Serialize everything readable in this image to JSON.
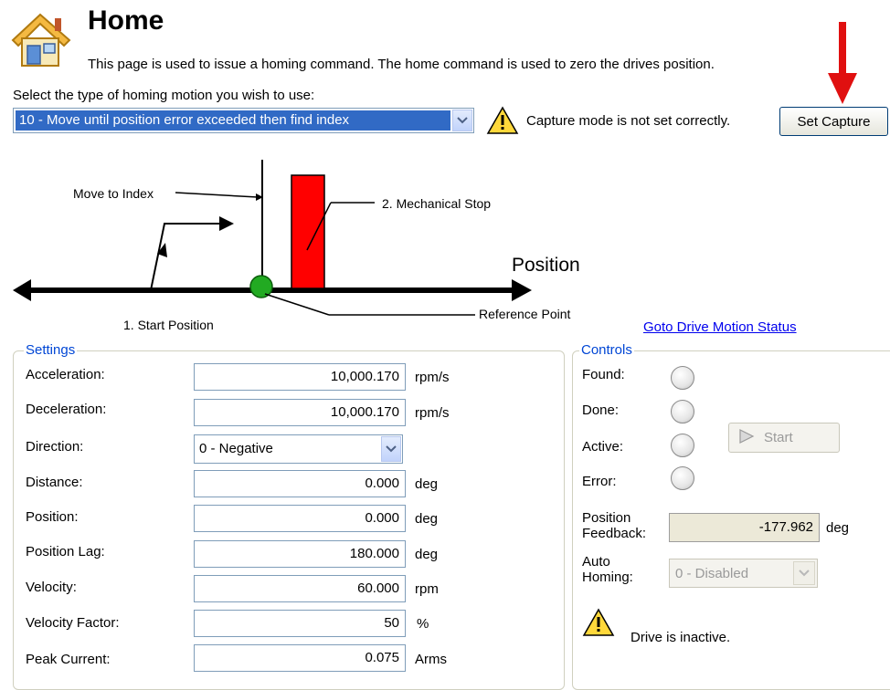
{
  "header": {
    "title": "Home",
    "description": "This page is used to issue a homing command. The home command is used to zero the drives position."
  },
  "homing": {
    "label": "Select the type of homing motion you wish to use:",
    "selected": "10 - Move until position error exceeded then find index",
    "warning": "Capture mode is not set correctly.",
    "set_capture": "Set Capture"
  },
  "diagram": {
    "move_to_index": "Move to Index",
    "mechanical_stop": "2. Mechanical Stop",
    "position": "Position",
    "reference_point": "Reference Point",
    "start_position": "1. Start Position"
  },
  "goto_link": "Goto Drive Motion Status",
  "settings": {
    "title": "Settings",
    "rows": [
      {
        "label": "Acceleration:",
        "value": "10,000.170",
        "unit": "rpm/s"
      },
      {
        "label": "Deceleration:",
        "value": "10,000.170",
        "unit": "rpm/s"
      },
      {
        "label": "Direction:",
        "value": "0 - Negative",
        "unit": ""
      },
      {
        "label": "Distance:",
        "value": "0.000",
        "unit": "deg"
      },
      {
        "label": "Position:",
        "value": "0.000",
        "unit": "deg"
      },
      {
        "label": "Position Lag:",
        "value": "180.000",
        "unit": "deg"
      },
      {
        "label": "Velocity:",
        "value": "60.000",
        "unit": "rpm"
      },
      {
        "label": "Velocity Factor:",
        "value": "50",
        "unit": "%"
      },
      {
        "label": "Peak Current:",
        "value": "0.075",
        "unit": "Arms"
      }
    ]
  },
  "controls": {
    "title": "Controls",
    "indicators": [
      "Found:",
      "Done:",
      "Active:",
      "Error:"
    ],
    "start": "Start",
    "feedback_label_1": "Position",
    "feedback_label_2": "Feedback:",
    "feedback_value": "-177.962",
    "feedback_unit": "deg",
    "auto_label_1": "Auto",
    "auto_label_2": "Homing:",
    "auto_value": "0 - Disabled",
    "status": "Drive is inactive."
  },
  "colors": {
    "accent_arrow": "#e01010",
    "stop_block": "#ff0000",
    "reference_dot": "#22aa22",
    "link": "#0000ee"
  },
  "icons": [
    "home-icon",
    "warning-icon",
    "dropdown-arrow-icon",
    "play-icon"
  ]
}
